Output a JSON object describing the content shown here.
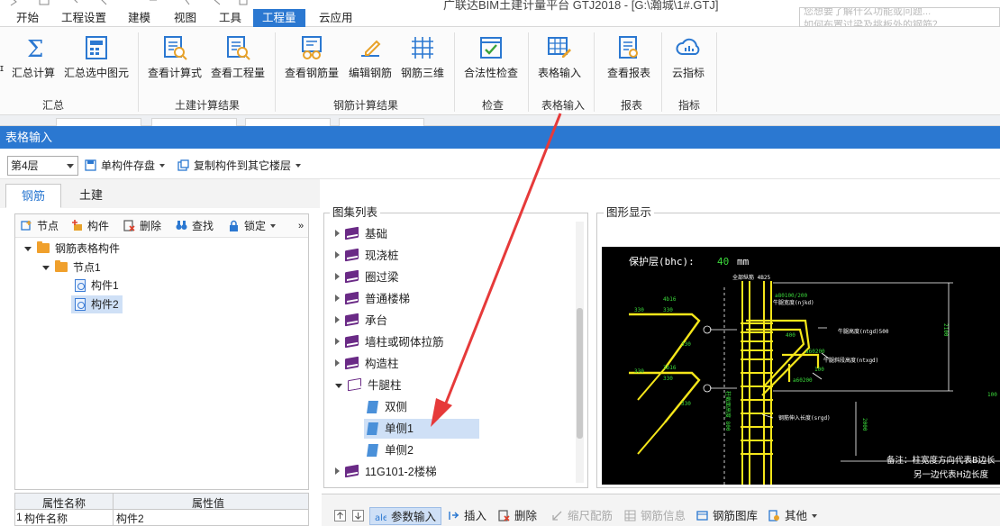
{
  "app": {
    "title_partial": "广联达BIM土建计量平台 GTJ2018 - [G:\\瀚城\\1#.GTJ]",
    "search_placeholder_line1": "您想要了解什么功能或问题...",
    "search_placeholder_line2": "如何布置过梁及挑板外的钢筋？"
  },
  "menu": [
    "开始",
    "工程设置",
    "建模",
    "视图",
    "工具",
    "工程量",
    "云应用"
  ],
  "menu_active": "工程量",
  "ribbon": {
    "buttons": [
      "汇总计算",
      "汇总选中图元",
      "查看计算式",
      "查看工程量",
      "查看钢筋量",
      "编辑钢筋",
      "钢筋三维",
      "合法性检查",
      "表格输入",
      "查看报表",
      "云指标"
    ],
    "groups": [
      "汇总",
      "土建计算结果",
      "钢筋计算结果",
      "检查",
      "表格输入",
      "报表",
      "指标"
    ]
  },
  "panel": {
    "title": "表格输入"
  },
  "toolbar": {
    "floor_select": "第4层",
    "single_save": "单构件存盘",
    "copy_to_floor": "复制构件到其它楼层"
  },
  "tabs": [
    "钢筋",
    "土建"
  ],
  "tabs_active": "钢筋",
  "tree_toolbar": [
    "节点",
    "构件",
    "删除",
    "查找",
    "锁定"
  ],
  "tree": {
    "root": "钢筋表格构件",
    "node": "节点1",
    "items": [
      "构件1",
      "构件2"
    ],
    "selected": "构件2"
  },
  "props": {
    "col_name": "属性名称",
    "col_value": "属性值",
    "row_index": "1",
    "row_name": "构件名称",
    "row_value": "构件2"
  },
  "atlas": {
    "title": "图集列表",
    "items": [
      "基础",
      "现浇桩",
      "圈过梁",
      "普通楼梯",
      "承台",
      "墙柱或砌体拉筋",
      "构造柱",
      "牛腿柱"
    ],
    "children": [
      "双侧",
      "单侧1",
      "单侧2"
    ],
    "after": "11G101-2楼梯",
    "selected": "单侧1"
  },
  "graphic": {
    "title": "图形显示",
    "cover_label": "保护层(bhc):",
    "cover_value": "40",
    "cover_unit": "mm",
    "texts": {
      "t1": "全部纵筋 4B25",
      "t2": "a80100/200",
      "t3": "牛腿宽度(njkd)",
      "t4": "4b16",
      "t5": "330",
      "t6": "330",
      "t7": "330",
      "t8": "牛腿高度(ntgd)500",
      "t9": "400",
      "t10": "a60200",
      "t11": "牛腿斜段高度(ntxgd)",
      "t12": "3b16",
      "t13": "330",
      "t14": "330",
      "t15": "330",
      "t16": "100",
      "t17": "a60200",
      "t18": "柱截面高度 800",
      "t19": "钢筋伸入长度(srgd)",
      "t20": "2100",
      "t21": "2000",
      "t22": "100",
      "note1": "备注：柱宽度方向代表B边长",
      "note2": "另一边代表H边长度"
    }
  },
  "bottom_toolbar": [
    "参数输入",
    "插入",
    "删除",
    "缩尺配筋",
    "钢筋信息",
    "钢筋图库",
    "其他"
  ],
  "colors": {
    "accent": "#2b78d1",
    "selection": "#cfe0f6",
    "rebar_yellow": "#f5e61a",
    "dim_white": "#ffffff",
    "annotation_red": "#e63a3a"
  }
}
